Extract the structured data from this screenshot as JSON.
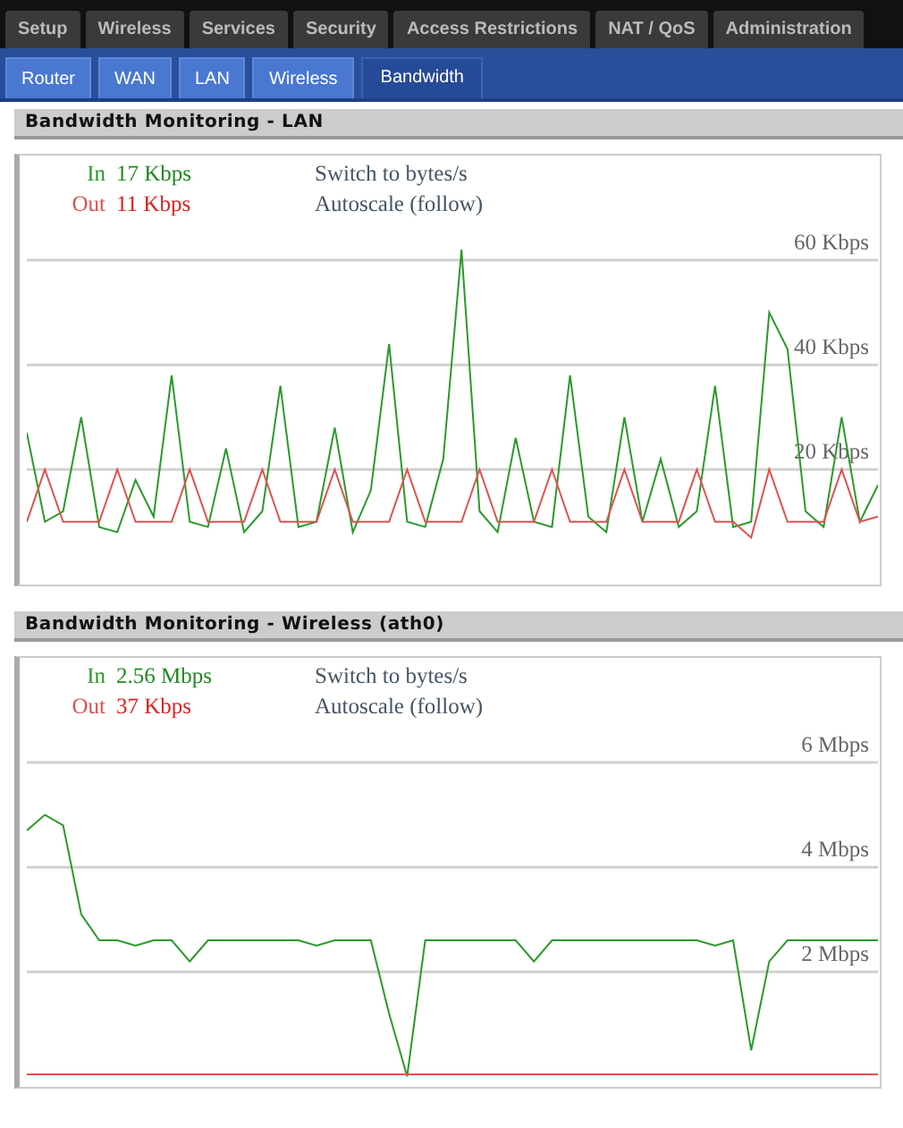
{
  "tabs": [
    {
      "label": "Setup"
    },
    {
      "label": "Wireless"
    },
    {
      "label": "Services"
    },
    {
      "label": "Security"
    },
    {
      "label": "Access Restrictions"
    },
    {
      "label": "NAT / QoS"
    },
    {
      "label": "Administration"
    }
  ],
  "subtabs": [
    {
      "label": "Router",
      "selected": false
    },
    {
      "label": "WAN",
      "selected": false
    },
    {
      "label": "LAN",
      "selected": false
    },
    {
      "label": "Wireless",
      "selected": false
    },
    {
      "label": "Bandwidth",
      "selected": true
    }
  ],
  "sections": [
    {
      "title": "Bandwidth Monitoring - LAN",
      "in_value": "17 Kbps",
      "out_value": "11 Kbps",
      "switch_link": "Switch to bytes/s",
      "autoscale_link": "Autoscale (follow)",
      "chart_data": {
        "type": "line",
        "grid": true,
        "ylim": [
          -2,
          80
        ],
        "yticks": [
          {
            "value": 60,
            "label": "60 Kbps"
          },
          {
            "value": 40,
            "label": "40 Kbps"
          },
          {
            "value": 20,
            "label": "20 Kbps"
          }
        ],
        "series": [
          {
            "name": "In",
            "color": "#2a9a2a",
            "values": [
              27,
              10,
              12,
              30,
              9,
              8,
              18,
              11,
              38,
              10,
              9,
              24,
              8,
              12,
              36,
              9,
              10,
              28,
              8,
              16,
              44,
              10,
              9,
              22,
              62,
              12,
              8,
              26,
              10,
              9,
              38,
              11,
              8,
              30,
              10,
              22,
              9,
              12,
              36,
              9,
              10,
              50,
              43,
              12,
              9,
              30,
              10,
              17
            ]
          },
          {
            "name": "Out",
            "color": "#e05050",
            "values": [
              10,
              20,
              10,
              10,
              10,
              20,
              10,
              10,
              10,
              20,
              10,
              10,
              10,
              20,
              10,
              10,
              10,
              20,
              10,
              10,
              10,
              20,
              10,
              10,
              10,
              20,
              10,
              10,
              10,
              20,
              10,
              10,
              10,
              20,
              10,
              10,
              10,
              20,
              10,
              10,
              7,
              20,
              10,
              10,
              10,
              20,
              10,
              11
            ]
          }
        ]
      }
    },
    {
      "title": "Bandwidth Monitoring - Wireless (ath0)",
      "in_value": "2.56 Mbps",
      "out_value": "37 Kbps",
      "switch_link": "Switch to bytes/s",
      "autoscale_link": "Autoscale (follow)",
      "chart_data": {
        "type": "line",
        "grid": true,
        "ylim": [
          -0.2,
          8
        ],
        "yticks": [
          {
            "value": 6,
            "label": "6 Mbps"
          },
          {
            "value": 4,
            "label": "4 Mbps"
          },
          {
            "value": 2,
            "label": "2 Mbps"
          }
        ],
        "series": [
          {
            "name": "In",
            "color": "#2a9a2a",
            "values": [
              4.7,
              5,
              4.8,
              3.1,
              2.6,
              2.6,
              2.5,
              2.6,
              2.6,
              2.2,
              2.6,
              2.6,
              2.6,
              2.6,
              2.6,
              2.6,
              2.5,
              2.6,
              2.6,
              2.6,
              1.2,
              0,
              2.6,
              2.6,
              2.6,
              2.6,
              2.6,
              2.6,
              2.2,
              2.6,
              2.6,
              2.6,
              2.6,
              2.6,
              2.6,
              2.6,
              2.6,
              2.6,
              2.5,
              2.6,
              0.5,
              2.2,
              2.6,
              2.6,
              2.6,
              2.6,
              2.6,
              2.6
            ]
          },
          {
            "name": "Out",
            "color": "#e05050",
            "values": [
              0.04,
              0.04,
              0.04,
              0.04,
              0.04,
              0.04,
              0.04,
              0.04,
              0.04,
              0.04,
              0.04,
              0.04,
              0.04,
              0.04,
              0.04,
              0.04,
              0.04,
              0.04,
              0.04,
              0.04,
              0.04,
              0.04,
              0.04,
              0.04,
              0.04,
              0.04,
              0.04,
              0.04,
              0.04,
              0.04,
              0.04,
              0.04,
              0.04,
              0.04,
              0.04,
              0.04,
              0.04,
              0.04,
              0.04,
              0.04,
              0.04,
              0.04,
              0.04,
              0.04,
              0.04,
              0.04,
              0.04,
              0.04
            ]
          }
        ]
      }
    }
  ]
}
